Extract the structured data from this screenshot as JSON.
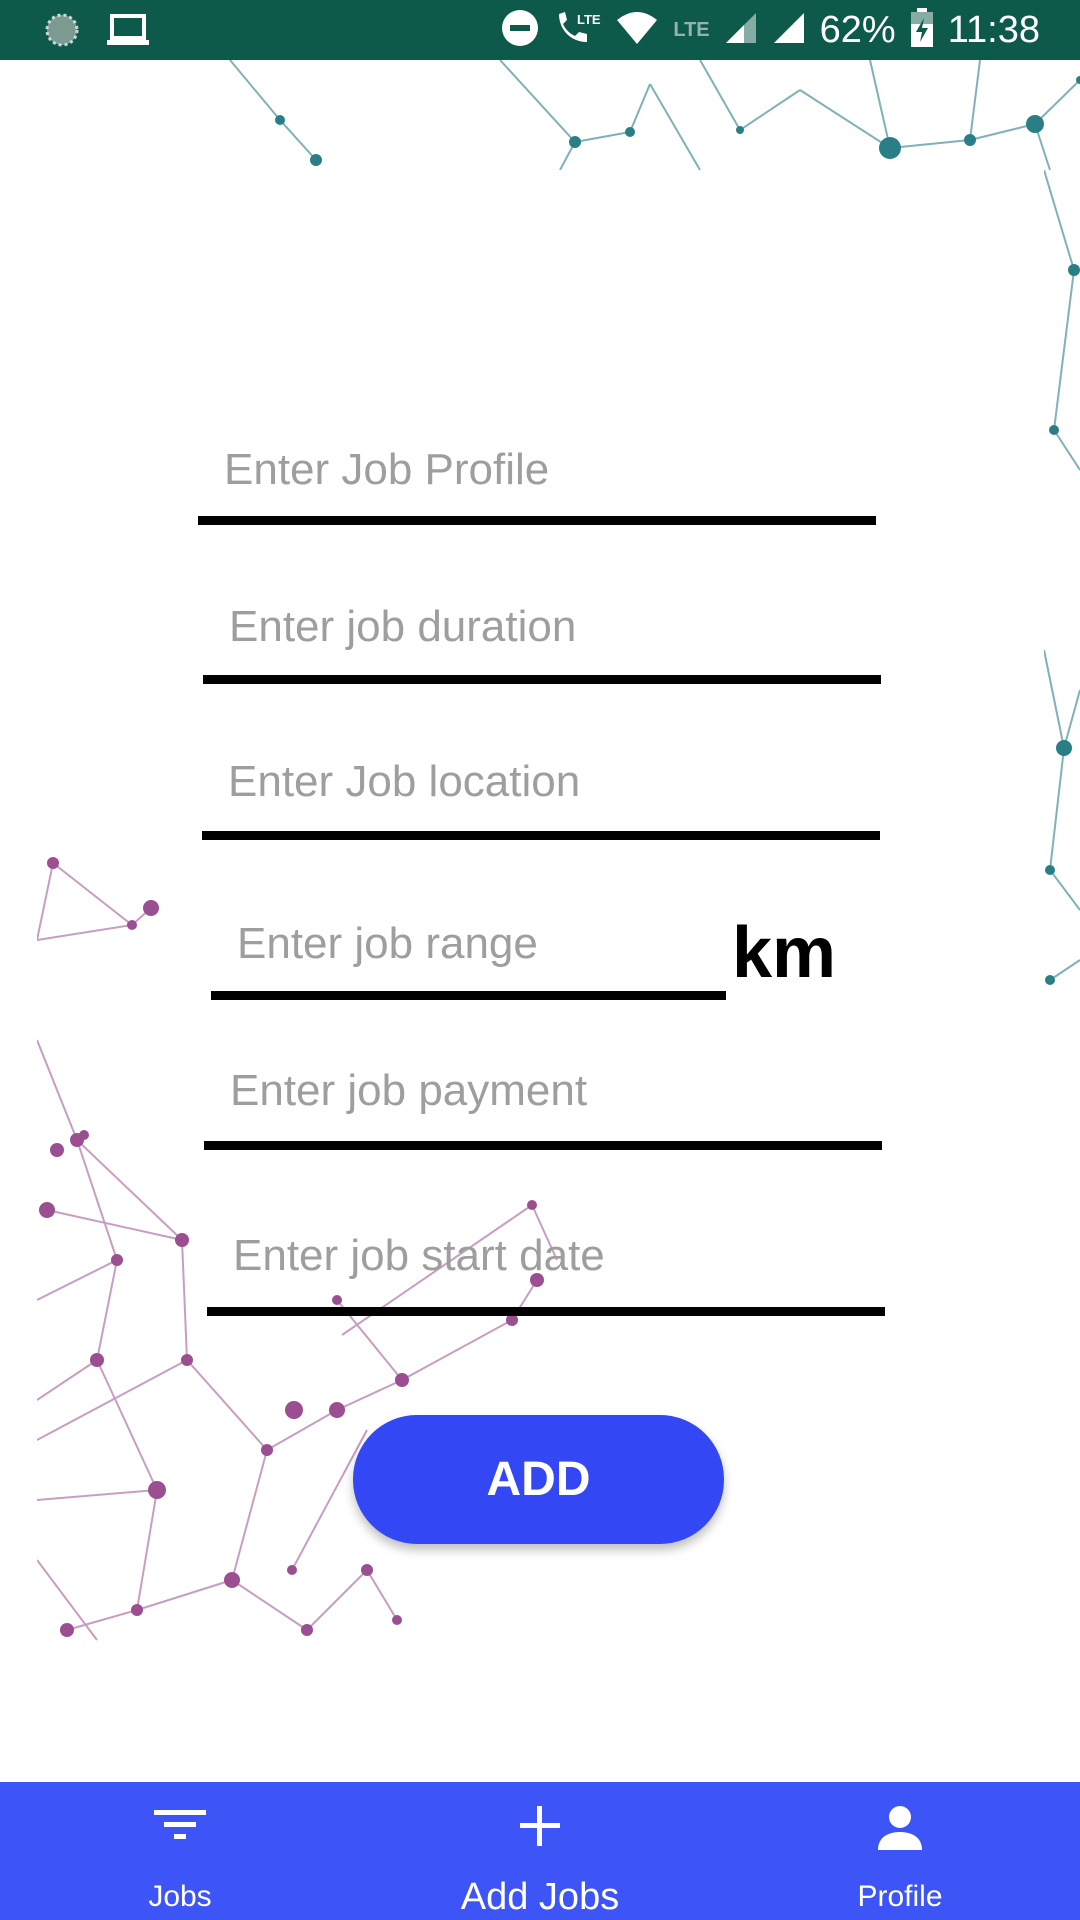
{
  "status_bar": {
    "battery": "62%",
    "time": "11:38",
    "network_label": "LTE",
    "icons": [
      "app-icon",
      "laptop-icon",
      "do-not-disturb-icon",
      "wifi-call-icon",
      "wifi-icon",
      "cell-signal-icon",
      "cell-signal-icon",
      "battery-charging-icon"
    ]
  },
  "form": {
    "job_profile": {
      "placeholder": "Enter Job Profile",
      "value": ""
    },
    "job_duration": {
      "placeholder": "Enter job duration",
      "value": ""
    },
    "job_location": {
      "placeholder": "Enter Job location",
      "value": ""
    },
    "job_range": {
      "placeholder": "Enter job range",
      "value": "",
      "unit": "km"
    },
    "job_payment": {
      "placeholder": "Enter job payment",
      "value": ""
    },
    "job_start_date": {
      "placeholder": "Enter job start date",
      "value": ""
    },
    "submit_label": "ADD"
  },
  "bottom_nav": {
    "items": [
      {
        "label": "Jobs",
        "icon": "filter-icon"
      },
      {
        "label": "Add Jobs",
        "icon": "plus-icon"
      },
      {
        "label": "Profile",
        "icon": "person-icon"
      }
    ]
  },
  "colors": {
    "status_bar": "#0d5a4a",
    "accent": "#3d55f7",
    "button": "#3447f5",
    "network_teal": "#2a7f86",
    "network_purple": "#9b4f91"
  }
}
